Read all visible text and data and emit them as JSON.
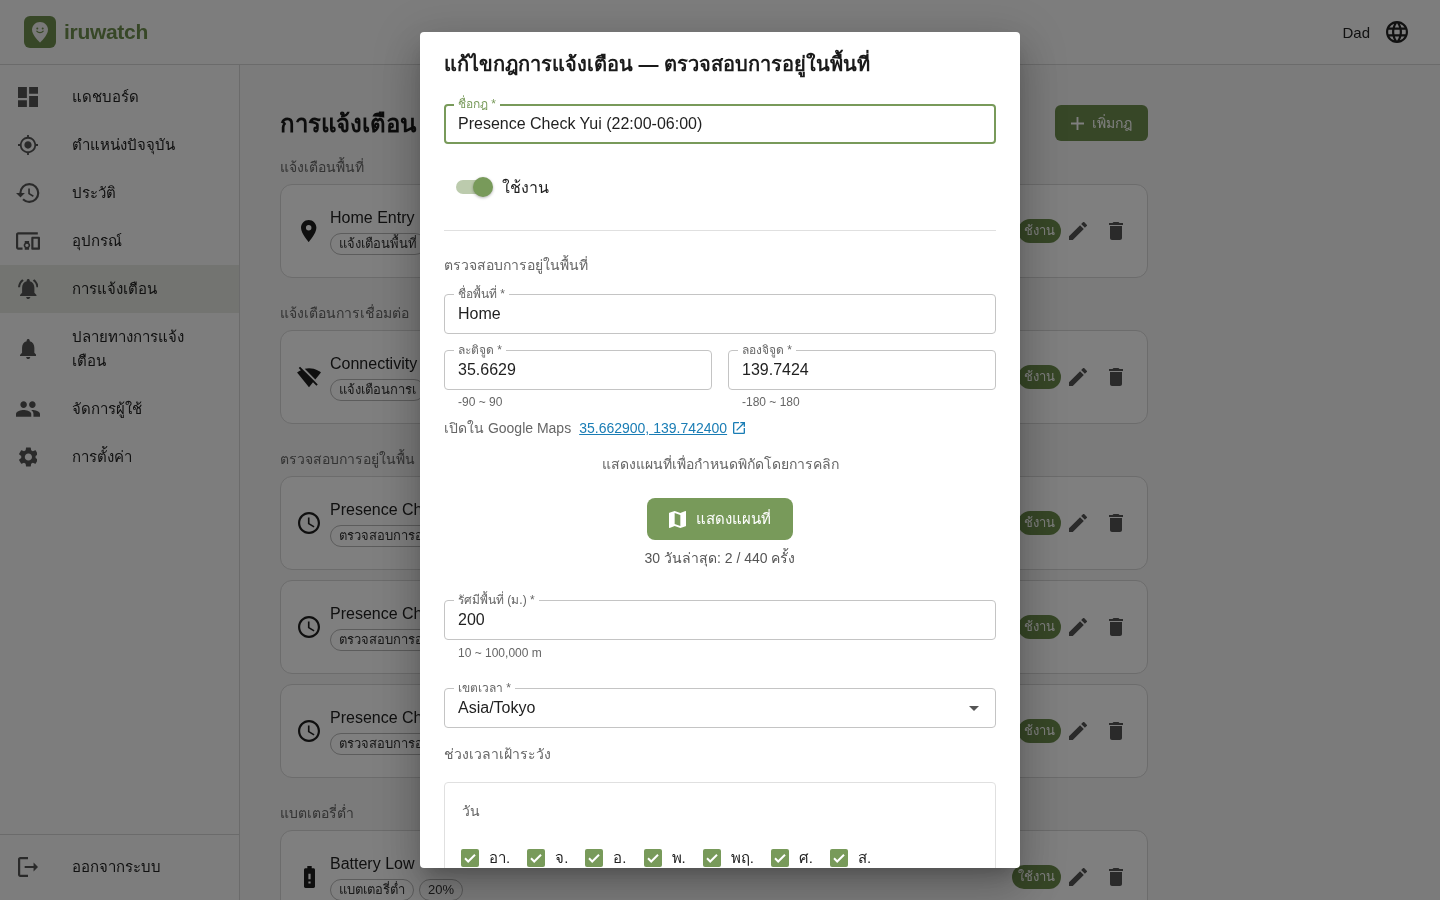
{
  "header": {
    "app_name": "iruwatch",
    "user": "Dad"
  },
  "sidebar": {
    "items": [
      {
        "label": "แดชบอร์ด",
        "selected": false
      },
      {
        "label": "ตำแหน่งปัจจุบัน",
        "selected": false
      },
      {
        "label": "ประวัติ",
        "selected": false
      },
      {
        "label": "อุปกรณ์",
        "selected": false
      },
      {
        "label": "การแจ้งเตือน",
        "selected": true
      },
      {
        "label": "ปลายทางการแจ้งเตือน",
        "selected": false
      },
      {
        "label": "จัดการผู้ใช้",
        "selected": false
      },
      {
        "label": "การตั้งค่า",
        "selected": false
      }
    ],
    "logout": "ออกจากระบบ"
  },
  "page": {
    "title": "การแจ้งเตือน",
    "add_button": "เพิ่มกฎ",
    "sections": [
      {
        "label": "แจ้งเตือนพื้นที่",
        "rules": [
          {
            "kind": "area",
            "name": "Home Entry",
            "tags": [
              "แจ้งเตือนพื้นที่"
            ],
            "status": "ช้งาน"
          }
        ]
      },
      {
        "label": "แจ้งเตือนการเชื่อมต่อ",
        "rules": [
          {
            "kind": "connectivity",
            "name": "Connectivity",
            "tags": [
              "แจ้งเตือนการเ"
            ],
            "status": "ช้งาน"
          }
        ]
      },
      {
        "label": "ตรวจสอบการอยู่ในพื้น",
        "rules": [
          {
            "kind": "presence",
            "name": "Presence Ch",
            "tags": [
              "ตรวจสอบการอ"
            ],
            "status": "ช้งาน"
          },
          {
            "kind": "presence",
            "name": "Presence Ch",
            "tags": [
              "ตรวจสอบการอ"
            ],
            "status": "ช้งาน"
          },
          {
            "kind": "presence",
            "name": "Presence Ch",
            "tags": [
              "ตรวจสอบการอ"
            ],
            "status": "ช้งาน"
          }
        ]
      },
      {
        "label": "แบตเตอรี่ต่ำ",
        "rules": [
          {
            "kind": "battery",
            "name": "Battery Low",
            "tags": [
              "แบตเตอรี่ต่ำ",
              "20%"
            ],
            "status": "ใช้งาน"
          }
        ]
      }
    ]
  },
  "dialog": {
    "title": "แก้ไขกฎการแจ้งเตือน — ตรวจสอบการอยู่ในพื้นที่",
    "rule_name": {
      "label": "ชื่อกฎ *",
      "value": "Presence Check Yui (22:00-06:00)",
      "focused": true
    },
    "enabled": {
      "label": "ใช้งาน",
      "on": true
    },
    "section_label": "ตรวจสอบการอยู่ในพื้นที่",
    "area_name": {
      "label": "ชื่อพื้นที่ *",
      "value": "Home"
    },
    "latitude": {
      "label": "ละติจูด *",
      "value": "35.6629",
      "helper": "-90 ~ 90"
    },
    "longitude": {
      "label": "ลองจิจูด *",
      "value": "139.7424",
      "helper": "-180 ~ 180"
    },
    "maps": {
      "label": "เปิดใน Google Maps",
      "link": "35.662900, 139.742400"
    },
    "map_hint": "แสดงแผนที่เพื่อกำหนดพิกัดโดยการคลิก",
    "map_button": "แสดงแผนที่",
    "stats": "30 วันล่าสุด: 2 / 440 ครั้ง",
    "radius": {
      "label": "รัศมีพื้นที่ (ม.) *",
      "value": "200",
      "helper": "10 ~ 100,000 m"
    },
    "timezone": {
      "label": "เขตเวลา *",
      "value": "Asia/Tokyo"
    },
    "schedule_label": "ช่วงเวลาเฝ้าระวัง",
    "days": {
      "label": "วัน",
      "items": [
        {
          "label": "อา.",
          "checked": true
        },
        {
          "label": "จ.",
          "checked": true
        },
        {
          "label": "อ.",
          "checked": true
        },
        {
          "label": "พ.",
          "checked": true
        },
        {
          "label": "พฤ.",
          "checked": true
        },
        {
          "label": "ศ.",
          "checked": true
        },
        {
          "label": "ส.",
          "checked": true
        }
      ]
    }
  }
}
